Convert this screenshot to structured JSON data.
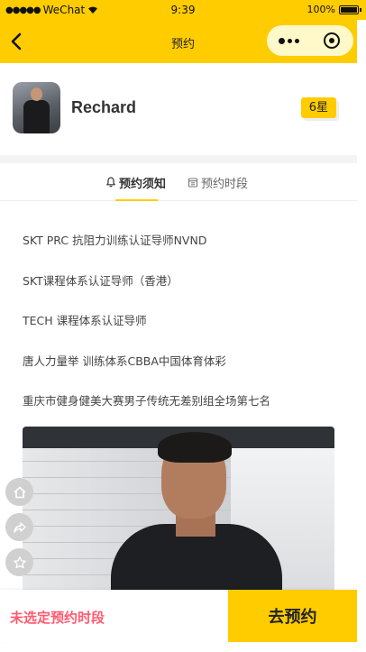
{
  "status_bar": {
    "carrier": "WeChat",
    "time": "9:39",
    "battery": "100%"
  },
  "nav": {
    "title": "预约"
  },
  "coach": {
    "name": "Rechard",
    "level": "6星"
  },
  "tabs": [
    {
      "label": "预约须知",
      "icon": "bell-icon",
      "active": true
    },
    {
      "label": "预约时段",
      "icon": "calendar-icon",
      "active": false
    }
  ],
  "certifications": [
    "SKT PRC 抗阻力训练认证导师NVND",
    "SKT课程体系认证导师（香港）",
    "TECH 课程体系认证导师",
    "唐人力量举 训练体系CBBA中国体育体彩",
    "重庆市健身健美大赛男子传统无差别组全场第七名"
  ],
  "side_actions": [
    "home-icon",
    "share-icon",
    "star-icon"
  ],
  "bottom": {
    "status": "未选定预约时段",
    "book_label": "去预约"
  },
  "colors": {
    "brand": "#ffcc00",
    "warning_text": "#ff5a6e"
  }
}
